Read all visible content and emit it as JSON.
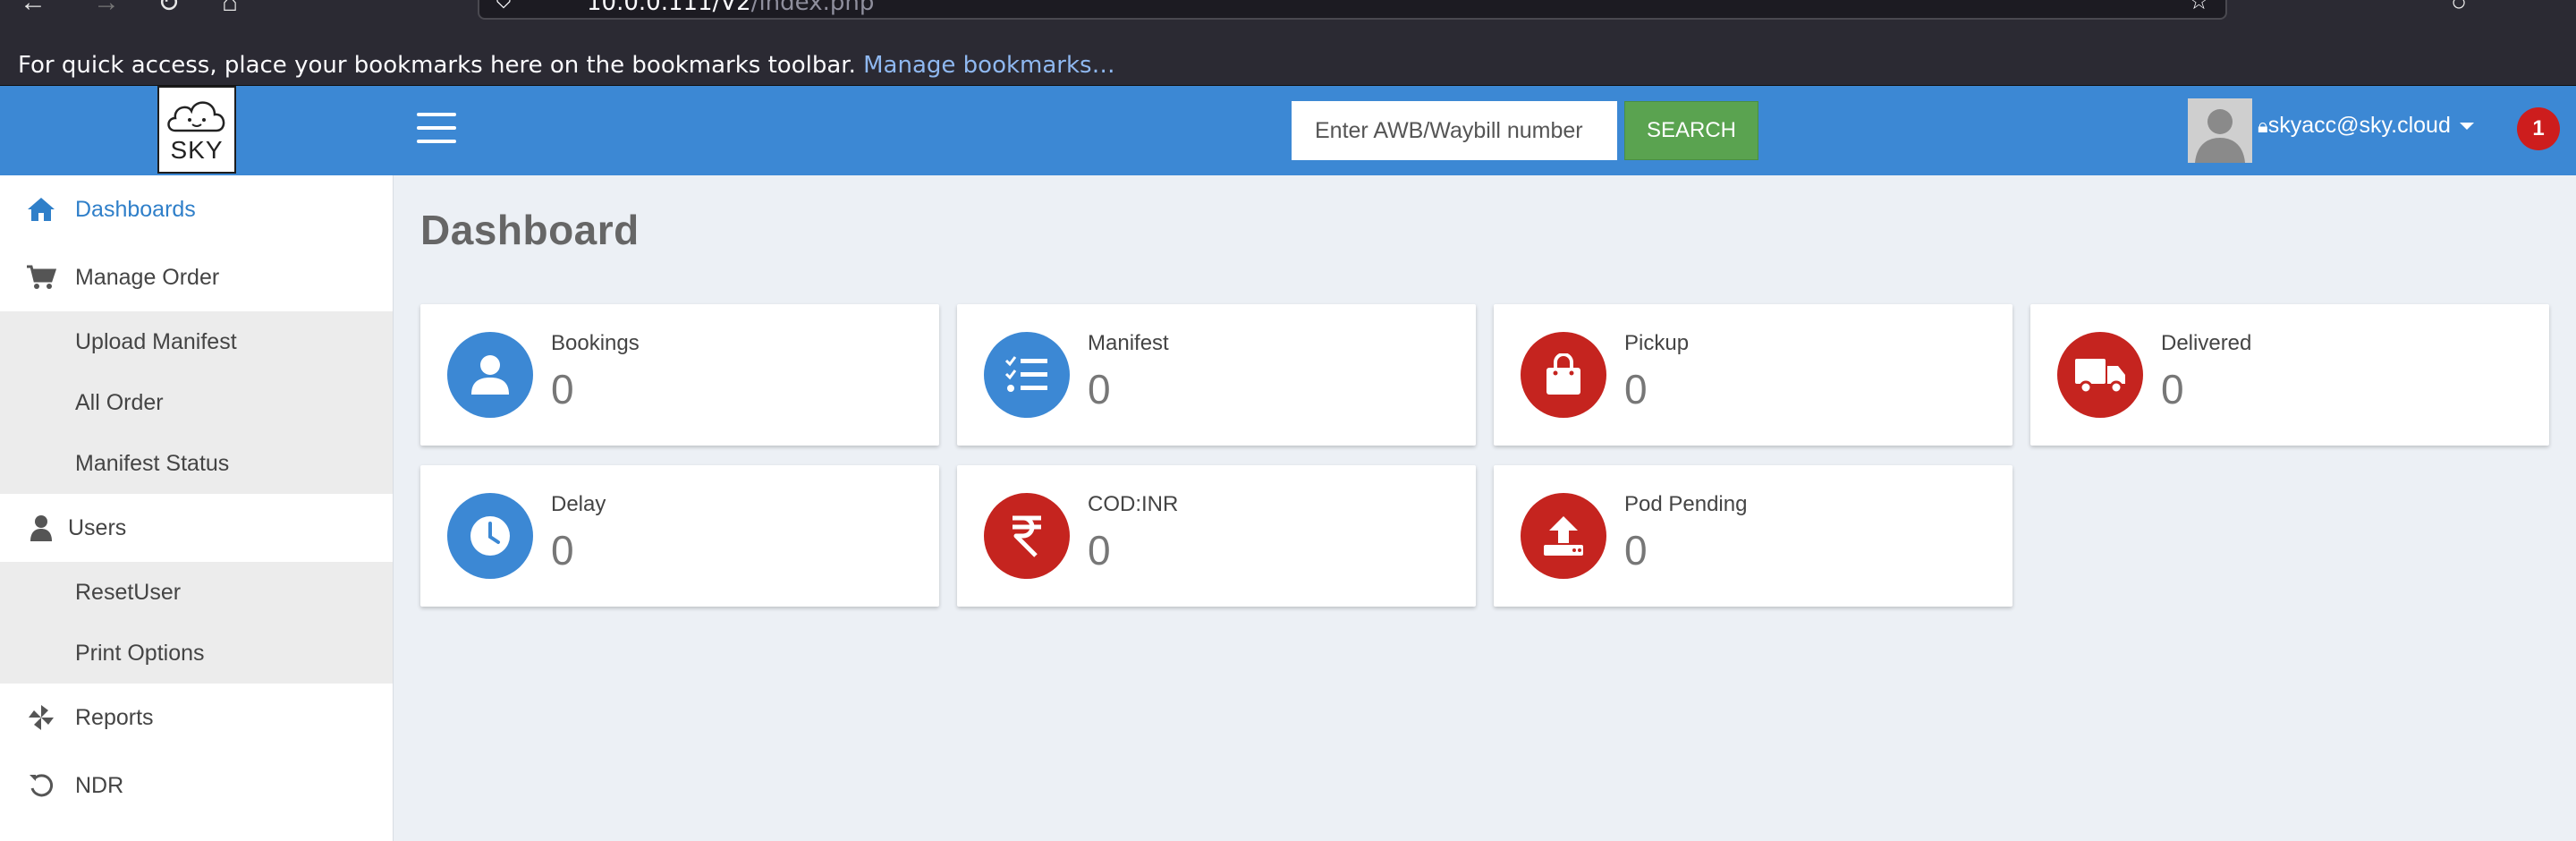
{
  "browser": {
    "url_host": "10.0.0.111/V2",
    "url_path": "/index.php",
    "bookmarks_message": "For quick access, place your bookmarks here on the bookmarks toolbar.",
    "manage_bookmarks": "Manage bookmarks…"
  },
  "header": {
    "logo_text": "SKY",
    "search_placeholder": "Enter AWB/Waybill number",
    "search_button": "SEARCH",
    "user_email": "skyacc@sky.cloud",
    "notification_count": "1",
    "accent_color": "#3c88d4"
  },
  "sidebar": {
    "items": [
      {
        "label": "Dashboards",
        "icon": "home-icon",
        "active": true
      },
      {
        "label": "Manage Order",
        "icon": "cart-icon"
      },
      {
        "label": "Upload Manifest"
      },
      {
        "label": "All Order"
      },
      {
        "label": "Manifest Status"
      },
      {
        "label": "Users",
        "icon": "user-icon"
      },
      {
        "label": "ResetUser"
      },
      {
        "label": "Print Options"
      },
      {
        "label": "Reports",
        "icon": "pinwheel-icon"
      },
      {
        "label": "NDR",
        "icon": "undo-icon"
      }
    ]
  },
  "main": {
    "title": "Dashboard",
    "cards": [
      {
        "label": "Bookings",
        "value": "0",
        "icon": "user-icon",
        "color": "#3c88d4"
      },
      {
        "label": "Manifest",
        "value": "0",
        "icon": "checklist-icon",
        "color": "#3c88d4"
      },
      {
        "label": "Pickup",
        "value": "0",
        "icon": "shopping-bag-icon",
        "color": "#c5241f"
      },
      {
        "label": "Delivered",
        "value": "0",
        "icon": "truck-icon",
        "color": "#c5241f"
      },
      {
        "label": "Delay",
        "value": "0",
        "icon": "clock-icon",
        "color": "#3c88d4"
      },
      {
        "label": "COD:INR",
        "value": "0",
        "icon": "rupee-icon",
        "color": "#c5241f"
      },
      {
        "label": "Pod Pending",
        "value": "0",
        "icon": "upload-icon",
        "color": "#c5241f"
      }
    ]
  }
}
